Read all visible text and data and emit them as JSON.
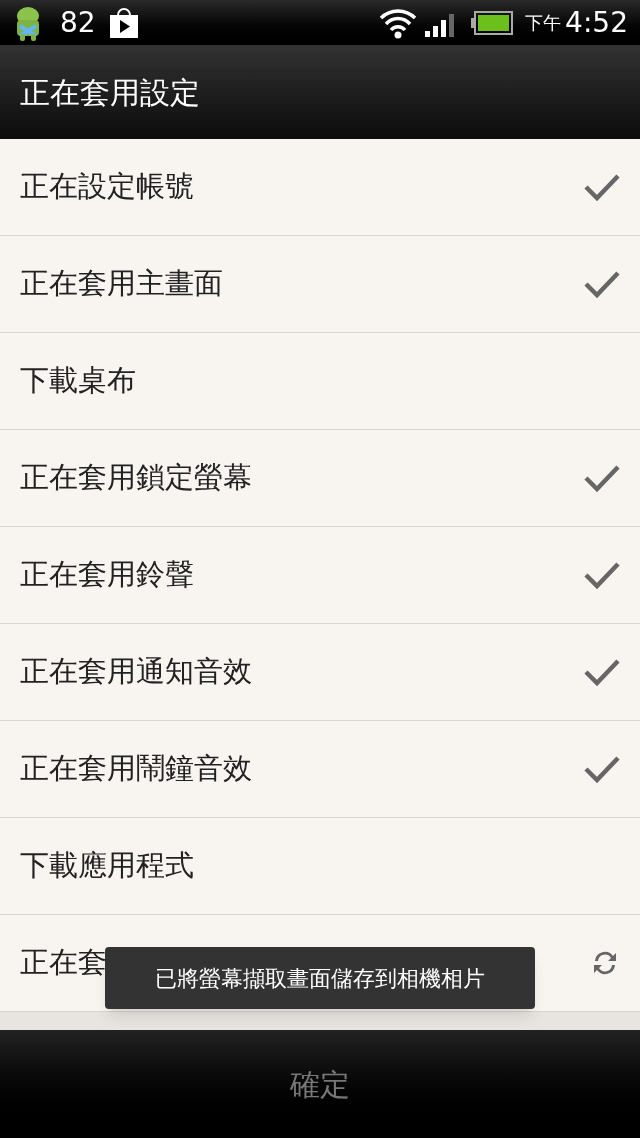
{
  "status_bar": {
    "battery_percent": "82",
    "time_period": "下午",
    "time": "4:52"
  },
  "title": "正在套用設定",
  "steps": [
    {
      "label": "正在設定帳號",
      "kind": "done"
    },
    {
      "label": "正在套用主畫面",
      "kind": "done"
    },
    {
      "label": "下載桌布",
      "kind": "pending"
    },
    {
      "label": "正在套用鎖定螢幕",
      "kind": "done"
    },
    {
      "label": "正在套用鈴聲",
      "kind": "done"
    },
    {
      "label": "正在套用通知音效",
      "kind": "done"
    },
    {
      "label": "正在套用鬧鐘音效",
      "kind": "done"
    },
    {
      "label": "下載應用程式",
      "kind": "pending"
    },
    {
      "label": "正在套",
      "kind": "syncing"
    }
  ],
  "toast": "已將螢幕擷取畫面儲存到相機相片",
  "confirm_button": {
    "label": "確定",
    "disabled": true
  }
}
